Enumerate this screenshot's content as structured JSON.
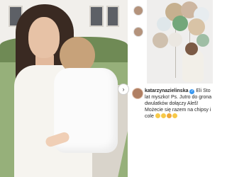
{
  "comment": {
    "username": "katarzynazielinska",
    "text": "Eli Sto lat myszko! Ps. Jutro do grona dwulatków dołączy Aleš! Możecie się razem na chipsy i cole",
    "emojis": [
      "smiling-face-icon",
      "smiling-face-icon",
      "heart-eyes-icon",
      "smiling-face-icon"
    ]
  },
  "icons": {
    "verified": "verified-badge-icon",
    "next": "chevron-right-icon"
  },
  "colors": {
    "verified_blue": "#3897f0",
    "text": "#262626"
  }
}
